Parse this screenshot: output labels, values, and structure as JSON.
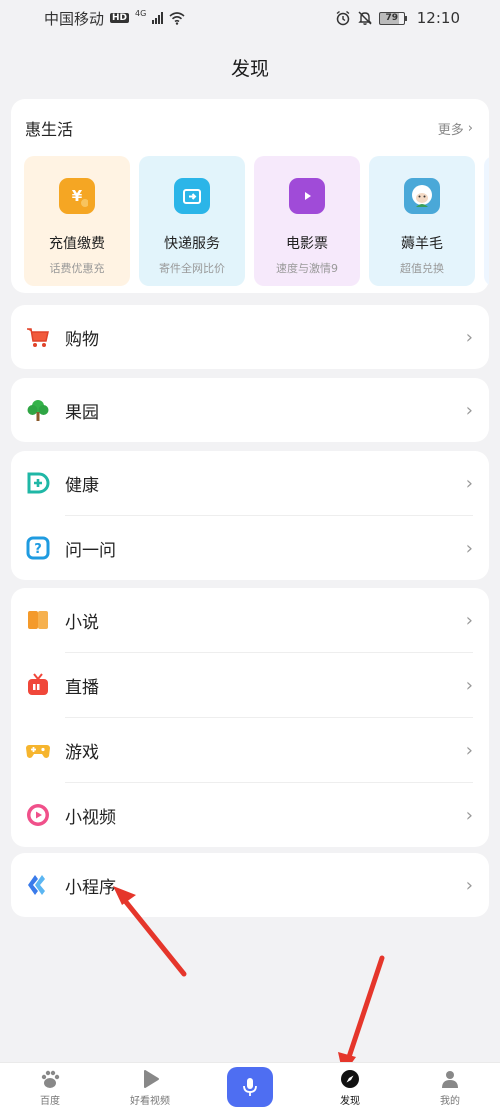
{
  "status_bar": {
    "carrier": "中国移动",
    "hd": "HD",
    "network": "4G",
    "battery": "79",
    "time": "12:10"
  },
  "page_title": "发现",
  "hui_shenghuo": {
    "title": "惠生活",
    "more_label": "更多",
    "tiles": [
      {
        "title": "充值缴费",
        "subtitle": "话费优惠充",
        "icon": "yuan-wallet-icon",
        "bg": "#fff3e3",
        "icon_color": "#f5a623"
      },
      {
        "title": "快递服务",
        "subtitle": "寄件全网比价",
        "icon": "delivery-box-icon",
        "bg": "#e2f4fb",
        "icon_color": "#2bb5e8"
      },
      {
        "title": "电影票",
        "subtitle": "速度与激情9",
        "icon": "movie-ticket-icon",
        "bg": "#f6e9fb",
        "icon_color": "#a04bd8"
      },
      {
        "title": "薅羊毛",
        "subtitle": "超值兑换",
        "icon": "sheep-icon",
        "bg": "#e4f4fc",
        "icon_color": "#4aa8d8"
      }
    ]
  },
  "groups": [
    {
      "items": [
        {
          "label": "购物",
          "icon": "cart-icon"
        }
      ]
    },
    {
      "items": [
        {
          "label": "果园",
          "icon": "tree-icon"
        }
      ]
    },
    {
      "items": [
        {
          "label": "健康",
          "icon": "health-icon"
        },
        {
          "label": "问一问",
          "icon": "question-icon"
        }
      ]
    },
    {
      "items": [
        {
          "label": "小说",
          "icon": "book-icon"
        },
        {
          "label": "直播",
          "icon": "tv-icon"
        },
        {
          "label": "游戏",
          "icon": "gamepad-icon"
        },
        {
          "label": "小视频",
          "icon": "play-icon"
        }
      ]
    },
    {
      "items": [
        {
          "label": "小程序",
          "icon": "mini-program-icon"
        }
      ]
    }
  ],
  "tabbar": {
    "tabs": [
      {
        "label": "百度",
        "icon": "baidu-paw-icon"
      },
      {
        "label": "好看视频",
        "icon": "video-play-icon"
      },
      {
        "label": "",
        "icon": "microphone-icon"
      },
      {
        "label": "发现",
        "icon": "compass-icon"
      },
      {
        "label": "我的",
        "icon": "profile-icon"
      }
    ],
    "active": "发现"
  },
  "colors": {
    "accent": "#4e6ef2",
    "arrow": "#e5362b"
  }
}
